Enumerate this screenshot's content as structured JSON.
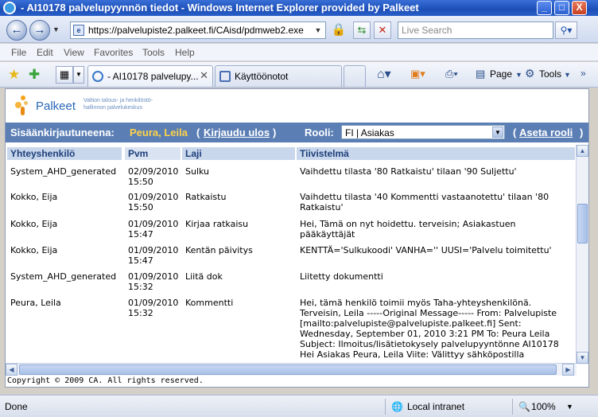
{
  "window": {
    "title": "- AI10178 palvelupyynnön tiedot - Windows Internet Explorer provided by Palkeet",
    "minimize": "_",
    "maximize": "□",
    "close": "X"
  },
  "address": {
    "url": "https://palvelupiste2.palkeet.fi/CAisd/pdmweb2.exe",
    "search_placeholder": "Live Search"
  },
  "menu": [
    "File",
    "Edit",
    "View",
    "Favorites",
    "Tools",
    "Help"
  ],
  "tabs": [
    {
      "label": "- AI10178 palvelupy..."
    },
    {
      "label": "Käyttöönotot"
    }
  ],
  "toolbar": {
    "page": "Page",
    "tools": "Tools"
  },
  "logo": {
    "name": "Palkeet",
    "tagline_1": "Valtion talous- ja henkilöstö-",
    "tagline_2": "hallinnon palvelukeskus"
  },
  "userbar": {
    "logged_in_label": "Sisäänkirjautuneena:",
    "user_name": "Peura, Leila",
    "logout": "Kirjaudu ulos",
    "role_label": "Rooli:",
    "role_value": "FI | Asiakas",
    "set_role": "Aseta rooli"
  },
  "table": {
    "columns": [
      "Yhteyshenkilö",
      "Pvm",
      "Laji",
      "Tiivistelmä"
    ],
    "rows": [
      {
        "contact": "System_AHD_generated",
        "date": "02/09/2010\n15:50",
        "type": "Sulku",
        "summary": "Vaihdettu tilasta '80 Ratkaistu' tilaan '90 Suljettu'"
      },
      {
        "contact": "Kokko, Eija",
        "date": "01/09/2010\n15:50",
        "type": "Ratkaistu",
        "summary": "Vaihdettu tilasta '40 Kommentti vastaanotettu' tilaan '80\nRatkaistu'"
      },
      {
        "contact": "Kokko, Eija",
        "date": "01/09/2010\n15:47",
        "type": "Kirjaa ratkaisu",
        "summary": "Hei, Tämä on nyt hoidettu. terveisin; Asiakastuen\npääkäyttäjät"
      },
      {
        "contact": "Kokko, Eija",
        "date": "01/09/2010\n15:47",
        "type": "Kentän päivitys",
        "summary": "KENTTÄ='Sulkukoodi' VANHA='' UUSI='Palvelu toimitettu'"
      },
      {
        "contact": "System_AHD_generated",
        "date": "01/09/2010\n15:32",
        "type": "Liitä dok",
        "summary": "Liitetty dokumentti"
      },
      {
        "contact": "Peura, Leila",
        "date": "01/09/2010\n15:32",
        "type": "Kommentti",
        "summary": "Hei, tämä henkilö toimii myös Taha-yhteyshenkilönä.\nTerveisin, Leila -----Original Message----- From: Palvelupiste\n[mailto:palvelupiste@palvelupiste.palkeet.fi] Sent:\nWednesday, September 01, 2010 3:21 PM To: Peura Leila\nSubject: Ilmoitus/lisätietokysely palvelupyyntönne AI10178\nHei Asiakas Peura, Leila Viite: Välittyy sähköpostilla"
      }
    ]
  },
  "footer": {
    "copyright": "Copyright © 2009 CA. All rights reserved."
  },
  "status": {
    "text": "Done",
    "zone": "Local intranet",
    "zoom": "100%"
  },
  "colors": {
    "userbar": "#5b7fb5",
    "user_name": "#ffd24a",
    "header": "#c9d7ec"
  }
}
